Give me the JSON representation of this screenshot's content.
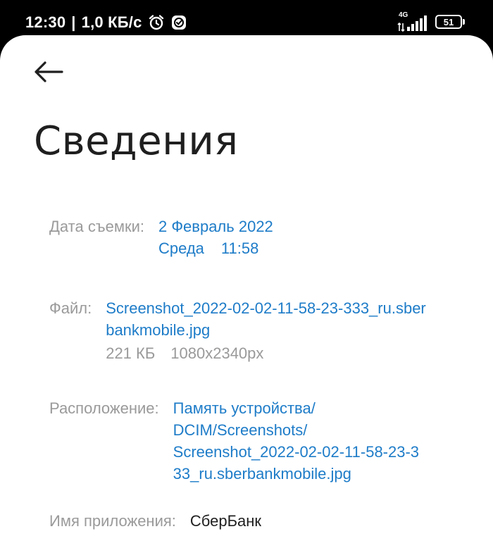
{
  "status_bar": {
    "time": "12:30",
    "separator": "|",
    "speed": "1,0 КБ/с",
    "network": "4G",
    "battery": "51",
    "icons": [
      "alarm-icon",
      "check-badge-icon",
      "signal-icon",
      "battery-icon"
    ]
  },
  "header": {
    "back_icon": "arrow-left-icon",
    "title": "Сведения"
  },
  "details": {
    "date": {
      "label": "Дата съемки:",
      "date": "2 Февраль 2022",
      "weekday": "Среда",
      "time": "11:58"
    },
    "file": {
      "label": "Файл:",
      "name_line1": "Screenshot_2022-02-02-11-58-23-333_ru.sber",
      "name_line2": "bankmobile.jpg",
      "size": "221 КБ",
      "resolution": "1080x2340px"
    },
    "location": {
      "label": "Расположение:",
      "line1": "Память устройства/",
      "line2": "DCIM/Screenshots/",
      "line3": "Screenshot_2022-02-02-11-58-23-3",
      "line4": "33_ru.sberbankmobile.jpg"
    },
    "app": {
      "label": "Имя приложения:",
      "value": "СберБанк"
    }
  },
  "colors": {
    "accent": "#1e7cc8",
    "label": "#9a9a9a",
    "text": "#1f1f1f",
    "background": "#ffffff",
    "status_bar": "#000000"
  }
}
